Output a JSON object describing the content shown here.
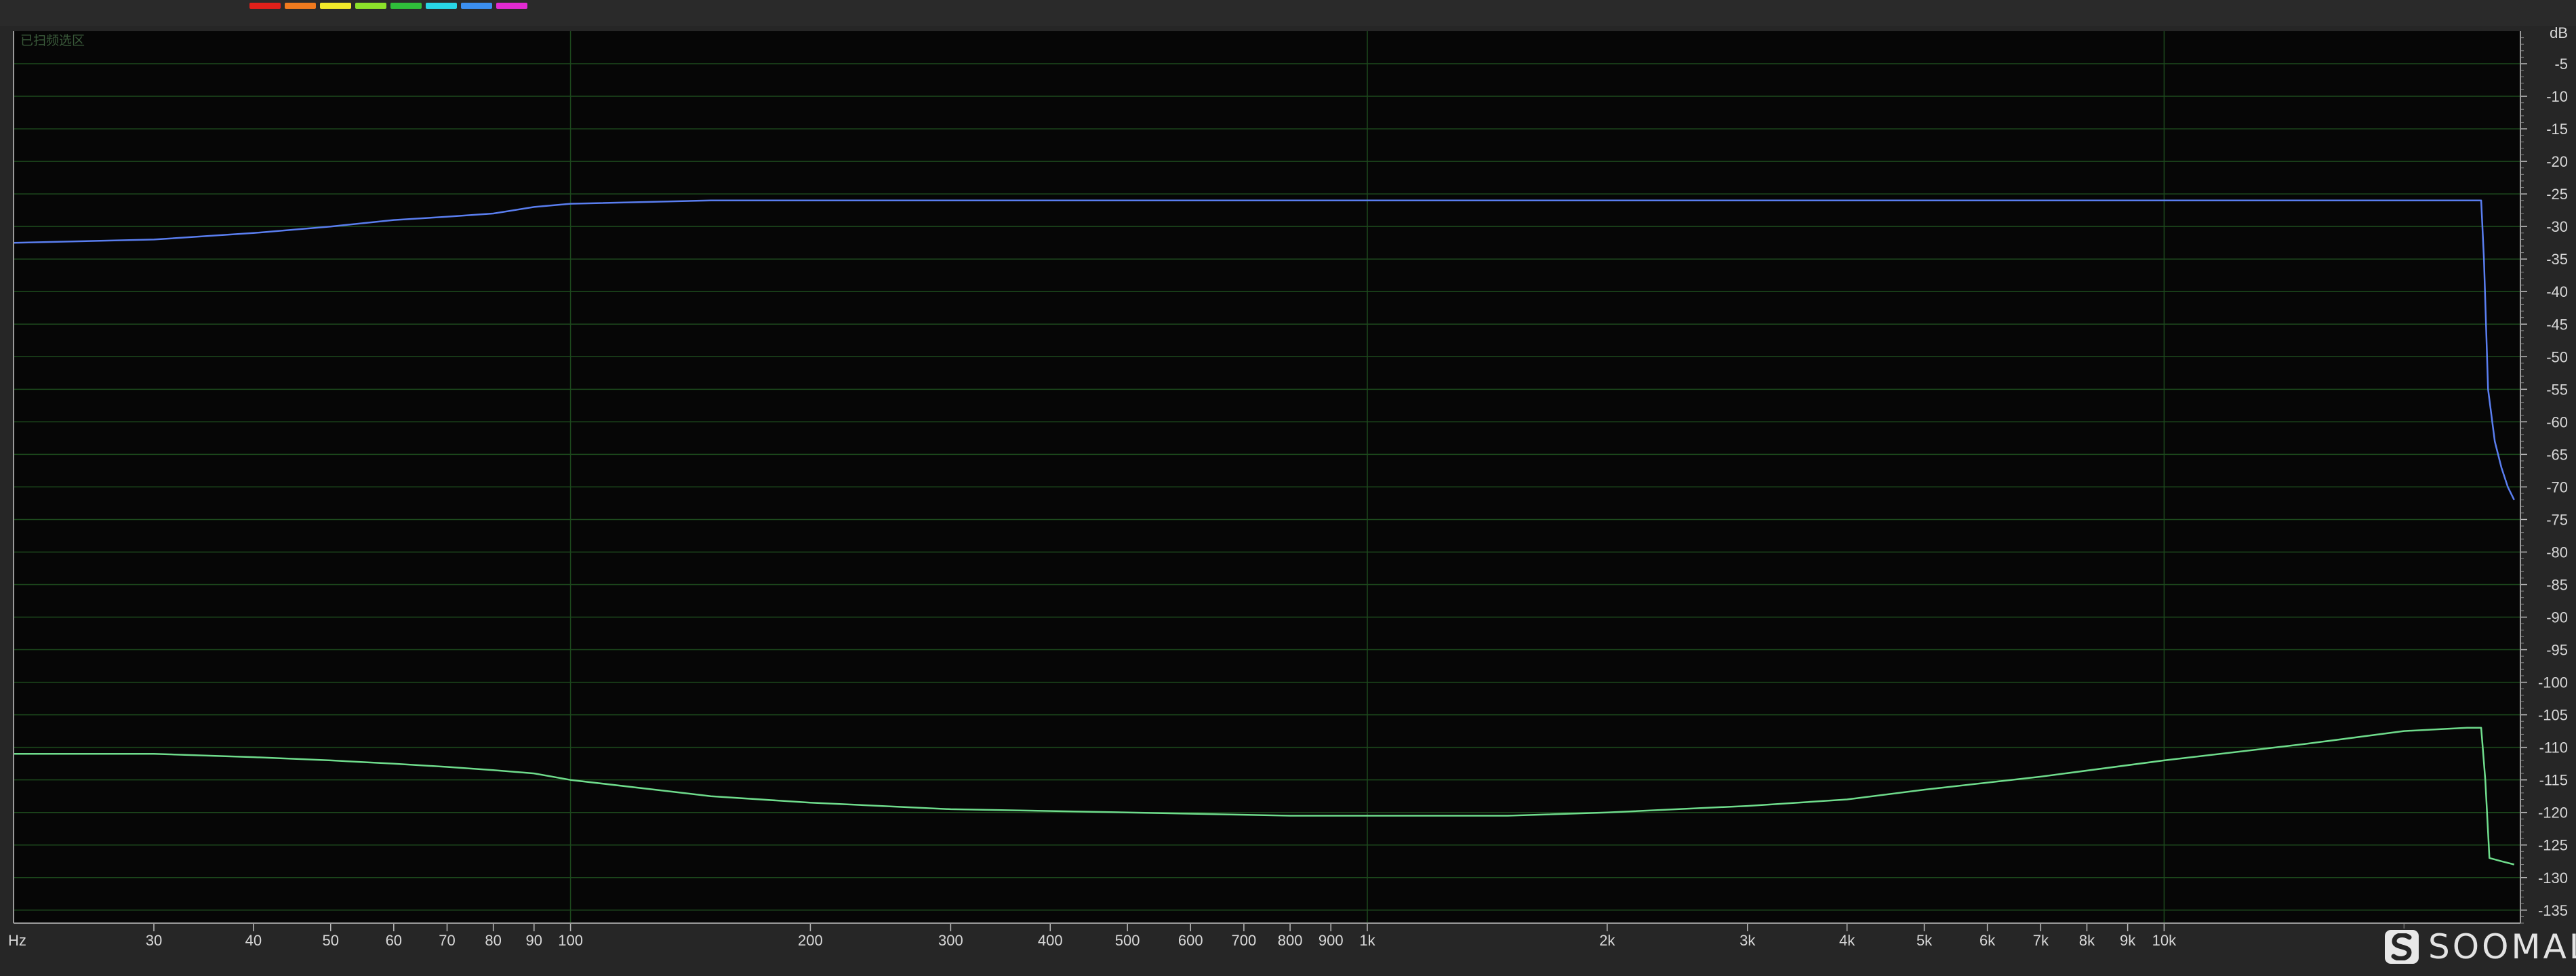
{
  "legend_swatches": [
    "#e0201a",
    "#f07a1e",
    "#f2ea2a",
    "#8ce22a",
    "#2fbf3a",
    "#28d6e6",
    "#3b8ff0",
    "#e22ad2"
  ],
  "brand": {
    "name": "SOOMAL",
    "icon": "soomal-logo-icon"
  },
  "colors": {
    "plot_bg": "#060606",
    "grid": "#1d4a1d",
    "axis_text": "#d8d8d8"
  },
  "chart_data": {
    "type": "line",
    "annotation": "已扫频选区",
    "x_unit": "Hz",
    "y_unit": "dB",
    "x_scale": "log",
    "xlim": [
      20,
      28000
    ],
    "ylim": [
      0,
      -137
    ],
    "grid": true,
    "x_ticks": [
      {
        "value": 30,
        "label": "30"
      },
      {
        "value": 40,
        "label": "40"
      },
      {
        "value": 50,
        "label": "50"
      },
      {
        "value": 60,
        "label": "60"
      },
      {
        "value": 70,
        "label": "70"
      },
      {
        "value": 80,
        "label": "80"
      },
      {
        "value": 90,
        "label": "90"
      },
      {
        "value": 100,
        "label": "100"
      },
      {
        "value": 200,
        "label": "200"
      },
      {
        "value": 300,
        "label": "300"
      },
      {
        "value": 400,
        "label": "400"
      },
      {
        "value": 500,
        "label": "500"
      },
      {
        "value": 600,
        "label": "600"
      },
      {
        "value": 700,
        "label": "700"
      },
      {
        "value": 800,
        "label": "800"
      },
      {
        "value": 900,
        "label": "900"
      },
      {
        "value": 1000,
        "label": "1k"
      },
      {
        "value": 2000,
        "label": "2k"
      },
      {
        "value": 3000,
        "label": "3k"
      },
      {
        "value": 4000,
        "label": "4k"
      },
      {
        "value": 5000,
        "label": "5k"
      },
      {
        "value": 6000,
        "label": "6k"
      },
      {
        "value": 7000,
        "label": "7k"
      },
      {
        "value": 8000,
        "label": "8k"
      },
      {
        "value": 9000,
        "label": "9k"
      },
      {
        "value": 10000,
        "label": "10k"
      }
    ],
    "y_ticks": [
      -5,
      -10,
      -15,
      -20,
      -25,
      -30,
      -35,
      -40,
      -45,
      -50,
      -55,
      -60,
      -65,
      -70,
      -75,
      -80,
      -85,
      -90,
      -95,
      -100,
      -105,
      -110,
      -115,
      -120,
      -125,
      -130,
      -135
    ],
    "series": [
      {
        "color": "#5a7ef0",
        "x": [
          20,
          30,
          40,
          50,
          60,
          70,
          80,
          90,
          100,
          150,
          200,
          500,
          1000,
          2000,
          5000,
          10000,
          20000,
          24000,
          25000,
          25200,
          25500,
          26000,
          26500,
          27000,
          27500
        ],
        "y": [
          -32.5,
          -32,
          -31,
          -30,
          -29,
          -28.5,
          -28,
          -27,
          -26.5,
          -26,
          -26,
          -26,
          -26,
          -26,
          -26,
          -26,
          -26,
          -26,
          -26,
          -35,
          -55,
          -63,
          -67,
          -70,
          -72
        ]
      },
      {
        "color": "#6fdc8c",
        "x": [
          20,
          30,
          40,
          50,
          60,
          70,
          80,
          90,
          100,
          150,
          200,
          300,
          500,
          800,
          1000,
          1500,
          2000,
          3000,
          4000,
          5000,
          7000,
          10000,
          15000,
          20000,
          24000,
          25000,
          25300,
          25600,
          26500,
          27500
        ],
        "y": [
          -111,
          -111,
          -111.5,
          -112,
          -112.5,
          -113,
          -113.5,
          -114,
          -115,
          -117.5,
          -118.5,
          -119.5,
          -120,
          -120.5,
          -120.5,
          -120.5,
          -120,
          -119,
          -118,
          -116.5,
          -114.5,
          -112,
          -109.5,
          -107.5,
          -107,
          -107,
          -115,
          -127,
          -127.5,
          -128
        ]
      }
    ]
  }
}
